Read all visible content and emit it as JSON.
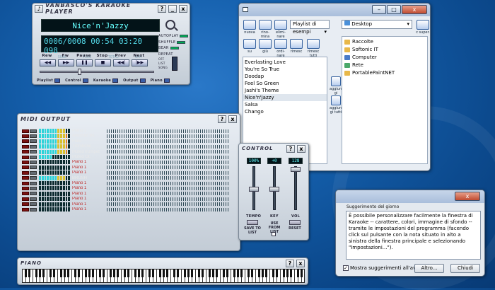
{
  "vanbasco": {
    "title": "VANBASCO'S KARAOKE PLAYER",
    "help": "?",
    "minimize": "_",
    "close": "x",
    "song": "Nice'n'Jazzy",
    "song_counter": "0006/0008",
    "time": "00:54",
    "total": "03:20",
    "bpm": "098",
    "labels": {
      "song": "SONG",
      "time": "TIME",
      "total": "TOTAL",
      "bpm": "BPM"
    },
    "side": {
      "autoplay": "AUTOPLAY",
      "shuffle": "SHUFFLE",
      "bear": "BEAR",
      "repeat": "REPEAT",
      "off": "OFF",
      "list": "LIST",
      "song": "SONG"
    },
    "transport": [
      "Rew",
      "Fw",
      "Pause",
      "Stop",
      "Prev",
      "Next"
    ],
    "bottom": [
      "Playlist",
      "Control",
      "Karaoke",
      "Output",
      "Piano"
    ]
  },
  "playlist": {
    "toolbar": {
      "new": "nuova",
      "rename": "rino-mina",
      "delete": "elimi-nare",
      "up": "su",
      "down": "giù",
      "sort": "ordi-nare",
      "shuffle": "rimesc",
      "shuffle_all": "rimesc tutti",
      "add": "aggiun-gi",
      "add_all": "aggiun-gi tutti",
      "up_folder": "c super."
    },
    "playlist_select": "Playlist di esempi",
    "folder_select": "Desktop",
    "songs": [
      "Everlasting Love",
      "You're So True",
      "Doodap",
      "Feel So Green",
      "Jashi's Theme",
      "Nice'n'Jazzy",
      "Salsa",
      "Chango"
    ],
    "selected_song": "Nice'n'Jazzy",
    "folders": [
      {
        "name": "Raccolte",
        "icon": "folder-icon",
        "color": "#e8b84a"
      },
      {
        "name": "Softonic IT",
        "icon": "folder-icon",
        "color": "#e8b84a"
      },
      {
        "name": "Computer",
        "icon": "computer-icon",
        "color": "#4a7bc8"
      },
      {
        "name": "Rete",
        "icon": "network-icon",
        "color": "#4aa86a"
      },
      {
        "name": "PortablePaintNET",
        "icon": "folder-icon",
        "color": "#e8b84a"
      }
    ]
  },
  "midi": {
    "title": "MIDI OUTPUT",
    "help": "?",
    "close": "x",
    "channels": [
      {
        "name": "Piano 1",
        "level": 0.85,
        "color": "#e8e8e8"
      },
      {
        "name": "Acoustic Bs.",
        "level": 0.95,
        "color": "#e8e8e8"
      },
      {
        "name": "Flute",
        "level": 0.9,
        "color": "#e8e8e8"
      },
      {
        "name": "Trombone",
        "level": 0.95,
        "color": "#e8e8e8"
      },
      {
        "name": "MutedTrumpet",
        "level": 0.95,
        "color": "#e8e8e8"
      },
      {
        "name": "Muted Gt.",
        "level": 0.4,
        "color": "#e8e8e8"
      },
      {
        "name": "Piano 1",
        "level": 0,
        "color": "#c03030"
      },
      {
        "name": "Piano 1",
        "level": 0,
        "color": "#c03030"
      },
      {
        "name": "Piano 1",
        "level": 0,
        "color": "#c03030"
      },
      {
        "name": "BRUSH",
        "level": 0.8,
        "color": "#e8e8e8"
      },
      {
        "name": "Piano 1",
        "level": 0,
        "color": "#c03030"
      },
      {
        "name": "Piano 1",
        "level": 0,
        "color": "#c03030"
      },
      {
        "name": "Piano 1",
        "level": 0,
        "color": "#c03030"
      },
      {
        "name": "Piano 1",
        "level": 0,
        "color": "#c03030"
      },
      {
        "name": "Piano 1",
        "level": 0,
        "color": "#c03030"
      },
      {
        "name": "Piano 1",
        "level": 0,
        "color": "#c03030"
      }
    ]
  },
  "control": {
    "title": "CONTROL",
    "help": "?",
    "close": "x",
    "tempo_value": "100%",
    "key_value": "+0",
    "vol_value": "128",
    "tempo_label": "TEMPO",
    "key_label": "KEY",
    "vol_label": "VOL",
    "save_label": "SAVE TO LIST",
    "use_label": "USE FROM LIST",
    "reset_label": "RESET",
    "tempo_level": 0.5,
    "key_level": 0.5,
    "vol_level": 1.0
  },
  "tip": {
    "title": "Suggerimento del giorno",
    "body": "È possibile personalizzare facilmente la finestra di Karaoke -- carattere, colori, immagine di sfondo -- tramite le impostazioni del programma (facendo click sul pulsante con la nota situato in alto a sinistra della finestra principale e selezionando \"Impostazioni...\").",
    "checkbox_label": "Mostra suggerimenti all'avvio",
    "checkbox_checked": true,
    "more_label": "Altro...",
    "close_label": "Chiudi",
    "close_x": "x"
  },
  "piano": {
    "title": "PIANO",
    "help": "?",
    "close": "x"
  }
}
